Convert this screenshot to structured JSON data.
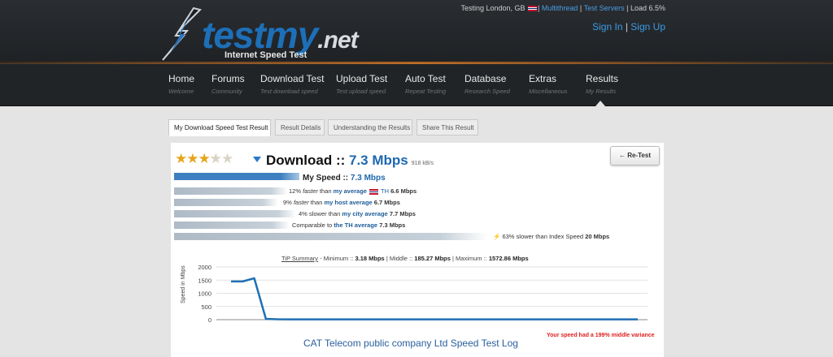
{
  "header": {
    "logo_text": "testmy",
    "logo_tld": ".net",
    "logo_tagline": "Internet Speed Test",
    "status_prefix": "Testing London, GB",
    "status_multithread": "Multithread",
    "status_test_servers": "Test Servers",
    "status_load": "Load 6.5%",
    "sign_in": "Sign In",
    "sign_up": "Sign Up"
  },
  "nav": [
    {
      "title": "Home",
      "sub": "Welcome"
    },
    {
      "title": "Forums",
      "sub": "Community"
    },
    {
      "title": "Download Test",
      "sub": "Test download speed"
    },
    {
      "title": "Upload Test",
      "sub": "Test upload speed"
    },
    {
      "title": "Auto Test",
      "sub": "Repeat Testing"
    },
    {
      "title": "Database",
      "sub": "Research Speed"
    },
    {
      "title": "Extras",
      "sub": "Miscellaneous"
    },
    {
      "title": "Results",
      "sub": "My Results"
    }
  ],
  "tabs": [
    "My Download Speed Test Result",
    "Result Details",
    "Understanding the Results",
    "Share This Result"
  ],
  "result": {
    "rating": 3.5,
    "title_prefix": "Download ::",
    "speed": "7.3 Mbps",
    "kbps": "918 kB/s",
    "retest_label": "← Re-Test",
    "my_speed_label": "My Speed ::",
    "my_speed_value": "7.3 Mbps",
    "comparisons": [
      {
        "pre": "12%",
        "adj": "faster",
        "mid": "than",
        "link": "my average",
        "flag": true,
        "extra": "TH",
        "val": "6.6 Mbps"
      },
      {
        "pre": "9%",
        "adj": "faster",
        "mid": "than",
        "link": "my host average",
        "flag": false,
        "extra": "",
        "val": "6.7 Mbps"
      },
      {
        "pre": "4%",
        "adj": "slower",
        "mid": "than",
        "link": "my city average",
        "flag": false,
        "extra": "",
        "val": "7.7 Mbps"
      },
      {
        "pre": "Comparable",
        "adj": "",
        "mid": "to",
        "link": "the TH average",
        "flag": false,
        "extra": "",
        "val": "7.3 Mbps"
      }
    ],
    "index_line": "63% slower than Index Speed",
    "index_value": "20 Mbps"
  },
  "summary": {
    "label": "TiP Summary",
    "min_label": "- Minimum ::",
    "min": "3.18 Mbps",
    "mid_label": "| Middle ::",
    "mid": "185.27 Mbps",
    "max_label": "| Maximum ::",
    "max": "1572.86 Mbps"
  },
  "chart_data": {
    "type": "line",
    "ylabel": "Speed in Mbps",
    "ylim": [
      0,
      2000
    ],
    "yticks": [
      0,
      500,
      1000,
      1500,
      2000
    ],
    "x": [
      0,
      1,
      2,
      3,
      4,
      5,
      6,
      7,
      8,
      9,
      10,
      11,
      12,
      13,
      14,
      15,
      16,
      17,
      18,
      19,
      20,
      21,
      22,
      23,
      24,
      25,
      26,
      27,
      28,
      29,
      30,
      31,
      32,
      33,
      34,
      35
    ],
    "values": [
      1450,
      1450,
      1570,
      30,
      15,
      12,
      10,
      10,
      10,
      10,
      10,
      10,
      10,
      10,
      10,
      10,
      10,
      10,
      10,
      10,
      10,
      10,
      10,
      10,
      10,
      10,
      10,
      10,
      10,
      10,
      10,
      10,
      10,
      10,
      10,
      10
    ],
    "color": "#1f6fb5"
  },
  "variance_note": "Your speed had a 199% middle variance",
  "log_title": "CAT Telecom public company Ltd Speed Test Log"
}
